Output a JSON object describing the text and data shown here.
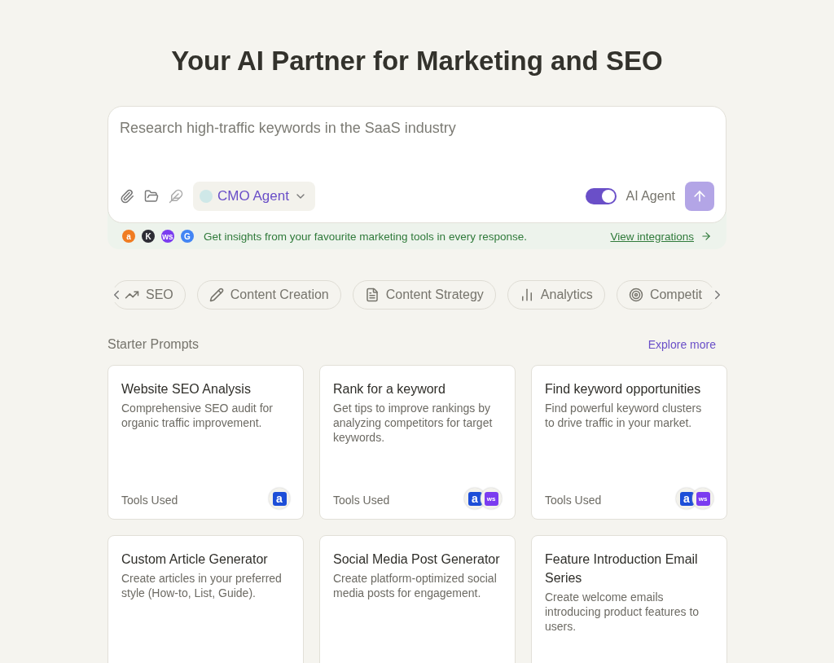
{
  "heading": "Your AI Partner for Marketing and SEO",
  "prompt": {
    "placeholder": "Research high-traffic keywords in the SaaS industry",
    "agent": "CMO Agent",
    "ai_agent_label": "AI Agent",
    "ai_agent_on": true
  },
  "integrations": {
    "logos": [
      {
        "mark": "a",
        "color": "#f07c22"
      },
      {
        "mark": "K",
        "color": "#2d2d35"
      },
      {
        "mark": "ws",
        "color": "#7b3cf0"
      },
      {
        "mark": "G",
        "color": "#4285f4"
      }
    ],
    "text": "Get insights from your favourite marketing tools in every response.",
    "link": "View integrations"
  },
  "categories": [
    {
      "label": "SEO",
      "kind": "trend",
      "selected": false
    },
    {
      "label": "Content Creation",
      "kind": "pencil",
      "selected": false
    },
    {
      "label": "Content Strategy",
      "kind": "doc",
      "selected": false
    },
    {
      "label": "Analytics",
      "kind": "bars",
      "selected": false
    },
    {
      "label": "Competit",
      "kind": "target",
      "selected": false
    }
  ],
  "starter_prompts": {
    "title": "Starter Prompts",
    "link": "Explore more",
    "cards": [
      {
        "title": "Website SEO Analysis",
        "description": "Comprehensive SEO audit for organic traffic improvement.",
        "tools_label": "Tools Used",
        "tools": [
          {
            "mark": "a",
            "color": "#1d4ed8"
          }
        ]
      },
      {
        "title": "Rank for a keyword",
        "description": "Get tips to improve rankings by analyzing competitors for target keywords.",
        "tools_label": "Tools Used",
        "tools": [
          {
            "mark": "a",
            "color": "#1d4ed8"
          },
          {
            "mark": "ws",
            "color": "#7b3cf0"
          }
        ]
      },
      {
        "title": "Find keyword opportunities",
        "description": "Find powerful keyword clusters to drive traffic in your market.",
        "tools_label": "Tools Used",
        "tools": [
          {
            "mark": "a",
            "color": "#1d4ed8"
          },
          {
            "mark": "ws",
            "color": "#7b3cf0"
          }
        ]
      },
      {
        "title": "Custom Article Generator",
        "description": "Create articles in your preferred style (How-to, List, Guide)."
      },
      {
        "title": "Social Media Post Generator",
        "description": "Create platform-optimized social media posts for engagement."
      },
      {
        "title": "Feature Introduction Email Series",
        "description": "Create welcome emails introducing product features to users."
      }
    ]
  }
}
